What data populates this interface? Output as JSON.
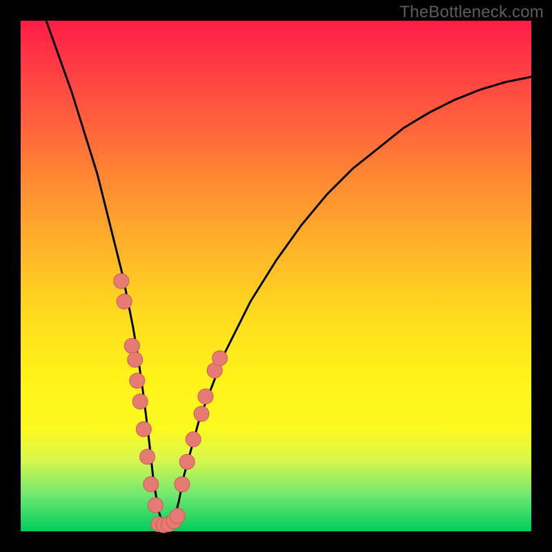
{
  "watermark": "TheBottleneck.com",
  "colors": {
    "frame": "#000000",
    "curve_stroke": "#000000",
    "marker_fill": "#e77a72",
    "marker_stroke": "#c45d57",
    "gradient_top": "#ff1c46",
    "gradient_bottom": "#00cc5c"
  },
  "chart_data": {
    "type": "line",
    "title": "",
    "subtitle": "",
    "xlabel": "",
    "ylabel": "",
    "xlim": [
      0,
      100
    ],
    "ylim": [
      0,
      100
    ],
    "grid": false,
    "legend": false,
    "annotations": [
      "TheBottleneck.com"
    ],
    "series": [
      {
        "name": "curve",
        "x": [
          5,
          10,
          15,
          18,
          20,
          22,
          23,
          24,
          25,
          26,
          27,
          28,
          29,
          30,
          31,
          32,
          35,
          40,
          45,
          50,
          55,
          60,
          65,
          70,
          75,
          80,
          85,
          90,
          95,
          100
        ],
        "values": [
          100,
          86,
          70,
          58,
          50,
          40,
          34,
          27,
          19,
          10,
          4,
          1,
          1,
          2,
          6,
          11,
          22,
          35,
          45,
          53,
          60,
          66,
          71,
          75,
          79,
          82,
          84.5,
          86.5,
          88,
          89
        ]
      },
      {
        "name": "markers_left",
        "x": [
          19.7,
          20.3,
          21.8,
          22.4,
          22.8,
          23.4,
          24.1,
          24.8,
          25.5,
          26.4
        ],
        "values": [
          49.0,
          45.0,
          36.3,
          33.6,
          29.5,
          25.4,
          20.0,
          14.6,
          9.2,
          5.1
        ]
      },
      {
        "name": "markers_bottom",
        "x": [
          27.0,
          28.0,
          29.0,
          30.0,
          30.7
        ],
        "values": [
          1.4,
          1.2,
          1.4,
          2.0,
          3.0
        ]
      },
      {
        "name": "markers_right",
        "x": [
          31.6,
          32.6,
          33.8,
          35.4,
          36.2,
          38.0,
          39.0
        ],
        "values": [
          9.2,
          13.6,
          18.0,
          23.0,
          26.4,
          31.5,
          33.9
        ]
      }
    ]
  }
}
